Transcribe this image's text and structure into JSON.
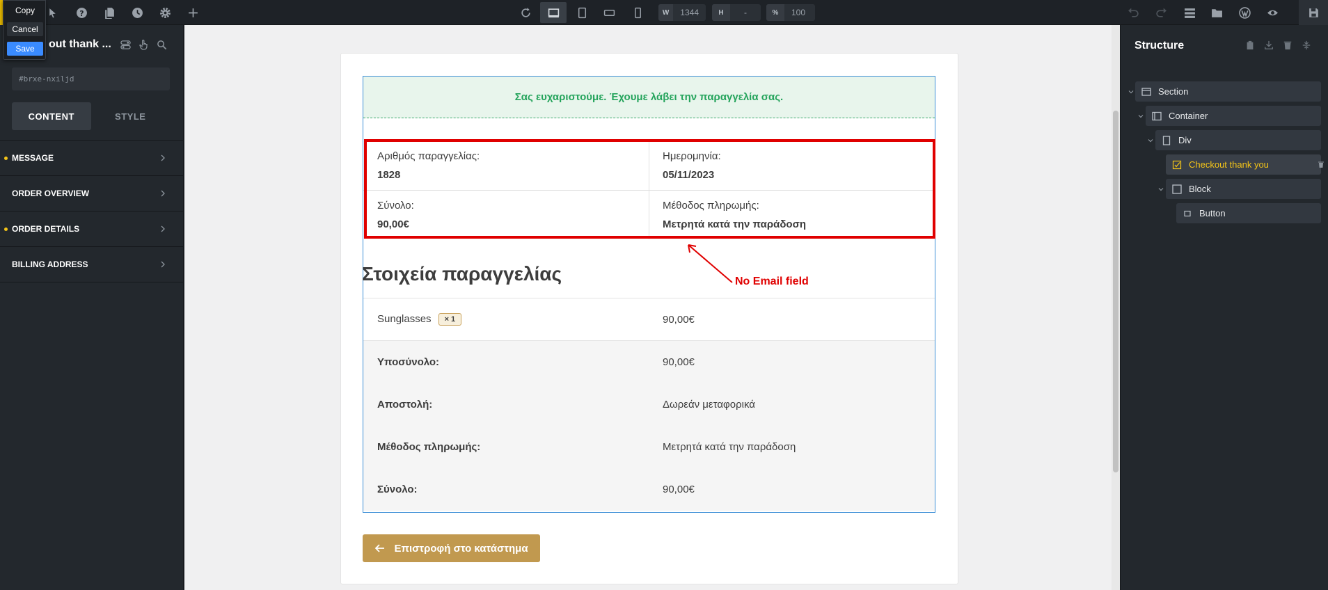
{
  "popup": {
    "copy": "Copy",
    "cancel": "Cancel",
    "save": "Save"
  },
  "toolbar": {
    "width_label": "W",
    "width_value": "1344",
    "height_label": "H",
    "height_value": "-",
    "zoom_label": "%",
    "zoom_value": "100"
  },
  "left_panel": {
    "title": "out thank ...",
    "element_id": "#brxe-nxiljd",
    "tabs": [
      "CONTENT",
      "STYLE"
    ],
    "sections": [
      {
        "label": "MESSAGE",
        "modified": true
      },
      {
        "label": "ORDER OVERVIEW",
        "modified": false
      },
      {
        "label": "ORDER DETAILS",
        "modified": true
      },
      {
        "label": "BILLING ADDRESS",
        "modified": false
      }
    ]
  },
  "canvas": {
    "thank_you_message": "Σας ευχαριστούμε. Έχουμε λάβει την παραγγελία σας.",
    "overview": [
      {
        "label": "Αριθμός παραγγελίας:",
        "value": "1828"
      },
      {
        "label": "Ημερομηνία:",
        "value": "05/11/2023"
      },
      {
        "label": "Σύνολο:",
        "value": "90,00€"
      },
      {
        "label": "Μέθοδος πληρωμής:",
        "value": "Μετρητά κατά την παράδοση"
      }
    ],
    "order_details_title": "Στοιχεία παραγγελίας",
    "item": {
      "name": "Sunglasses",
      "qty": "× 1",
      "price": "90,00€"
    },
    "totals": [
      {
        "label": "Υποσύνολο:",
        "value": "90,00€"
      },
      {
        "label": "Αποστολή:",
        "value": "Δωρεάν μεταφορικά"
      },
      {
        "label": "Μέθοδος πληρωμής:",
        "value": "Μετρητά κατά την παράδοση"
      },
      {
        "label": "Σύνολο:",
        "value": "90,00€"
      }
    ],
    "back_button": "Επιστροφή στο κατάστημα",
    "annotation": "No Email field"
  },
  "structure": {
    "title": "Structure",
    "tree": [
      {
        "label": "Section",
        "depth": 0
      },
      {
        "label": "Container",
        "depth": 1
      },
      {
        "label": "Div",
        "depth": 2
      },
      {
        "label": "Checkout thank you",
        "depth": 3,
        "selected": true
      },
      {
        "label": "Block",
        "depth": 3
      },
      {
        "label": "Button",
        "depth": 4
      }
    ]
  },
  "colors": {
    "accent": "#3a8bff",
    "modified_dot": "#f5c518",
    "success": "#25a45c",
    "annotation": "#e00000",
    "button_gold": "#c1994f"
  }
}
